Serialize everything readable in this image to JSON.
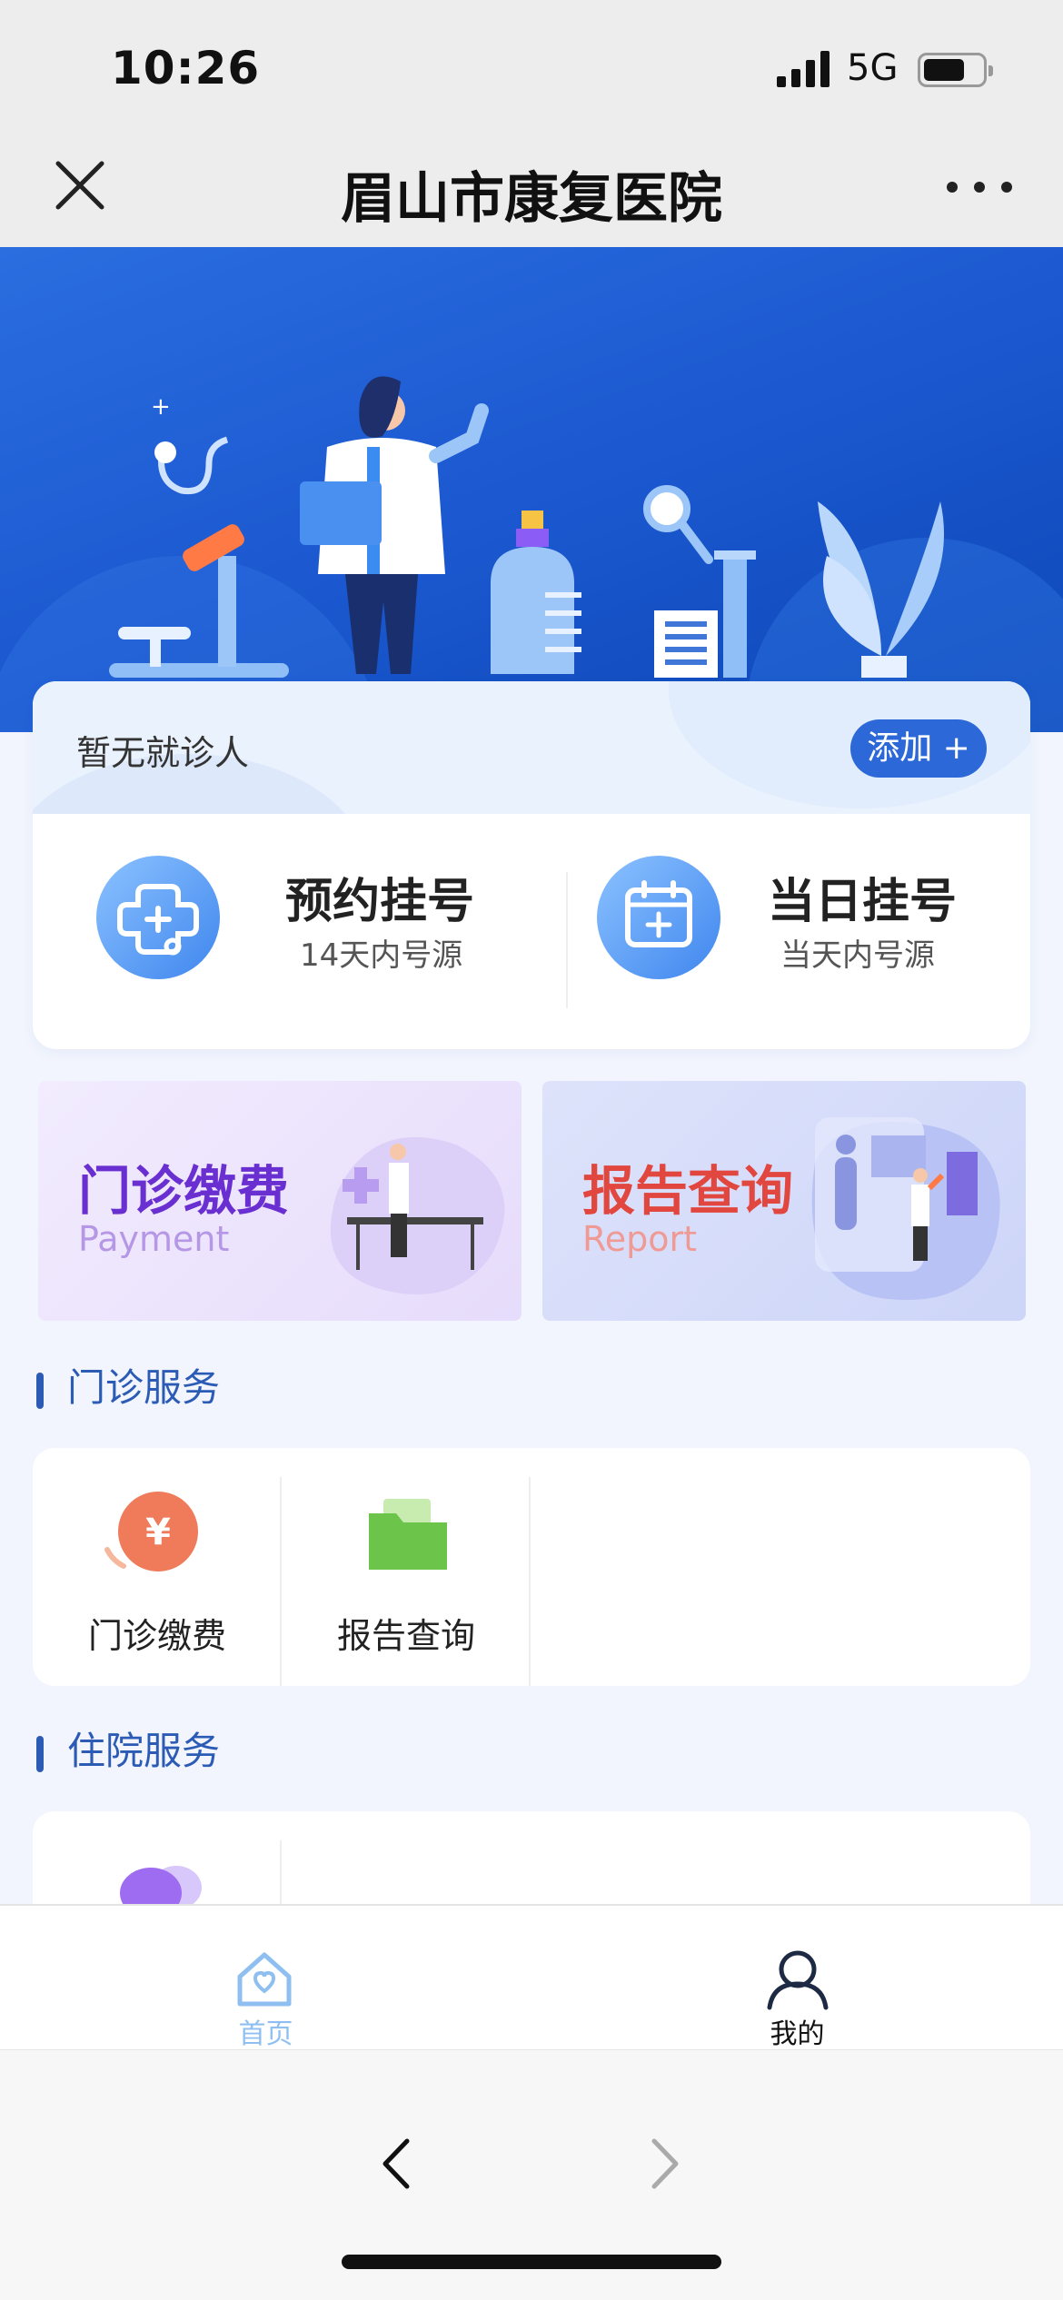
{
  "status_bar": {
    "time": "10:26",
    "network": "5G"
  },
  "header": {
    "title": "眉山市康复医院",
    "close_icon": "close-icon",
    "more_icon": "more-icon"
  },
  "patient": {
    "empty_text": "暂无就诊人",
    "add_label": "添加 +"
  },
  "registration": [
    {
      "title": "预约挂号",
      "subtitle": "14天内号源",
      "icon": "medical-cross-icon"
    },
    {
      "title": "当日挂号",
      "subtitle": "当天内号源",
      "icon": "calendar-plus-icon"
    }
  ],
  "banners": [
    {
      "title": "门诊缴费",
      "subtitle": "Payment",
      "title_color": "#6a2fd0",
      "subtitle_color": "#b597e6"
    },
    {
      "title": "报告查询",
      "subtitle": "Report",
      "title_color": "#e1463f",
      "subtitle_color": "#ef9a94"
    }
  ],
  "outpatient": {
    "title": "门诊服务",
    "items": [
      {
        "label": "门诊缴费",
        "icon": "yuan-payment-icon"
      },
      {
        "label": "报告查询",
        "icon": "folder-icon"
      }
    ]
  },
  "inpatient": {
    "title": "住院服务",
    "items": [
      {
        "icon": "heart-icon"
      }
    ]
  },
  "tabbar": [
    {
      "label": "首页",
      "icon": "home-icon",
      "active": true
    },
    {
      "label": "我的",
      "icon": "user-icon",
      "active": false
    }
  ],
  "colors": {
    "primary": "#2d68d8",
    "section_title": "#2c5bb6",
    "tab_active": "#8fbff0"
  }
}
